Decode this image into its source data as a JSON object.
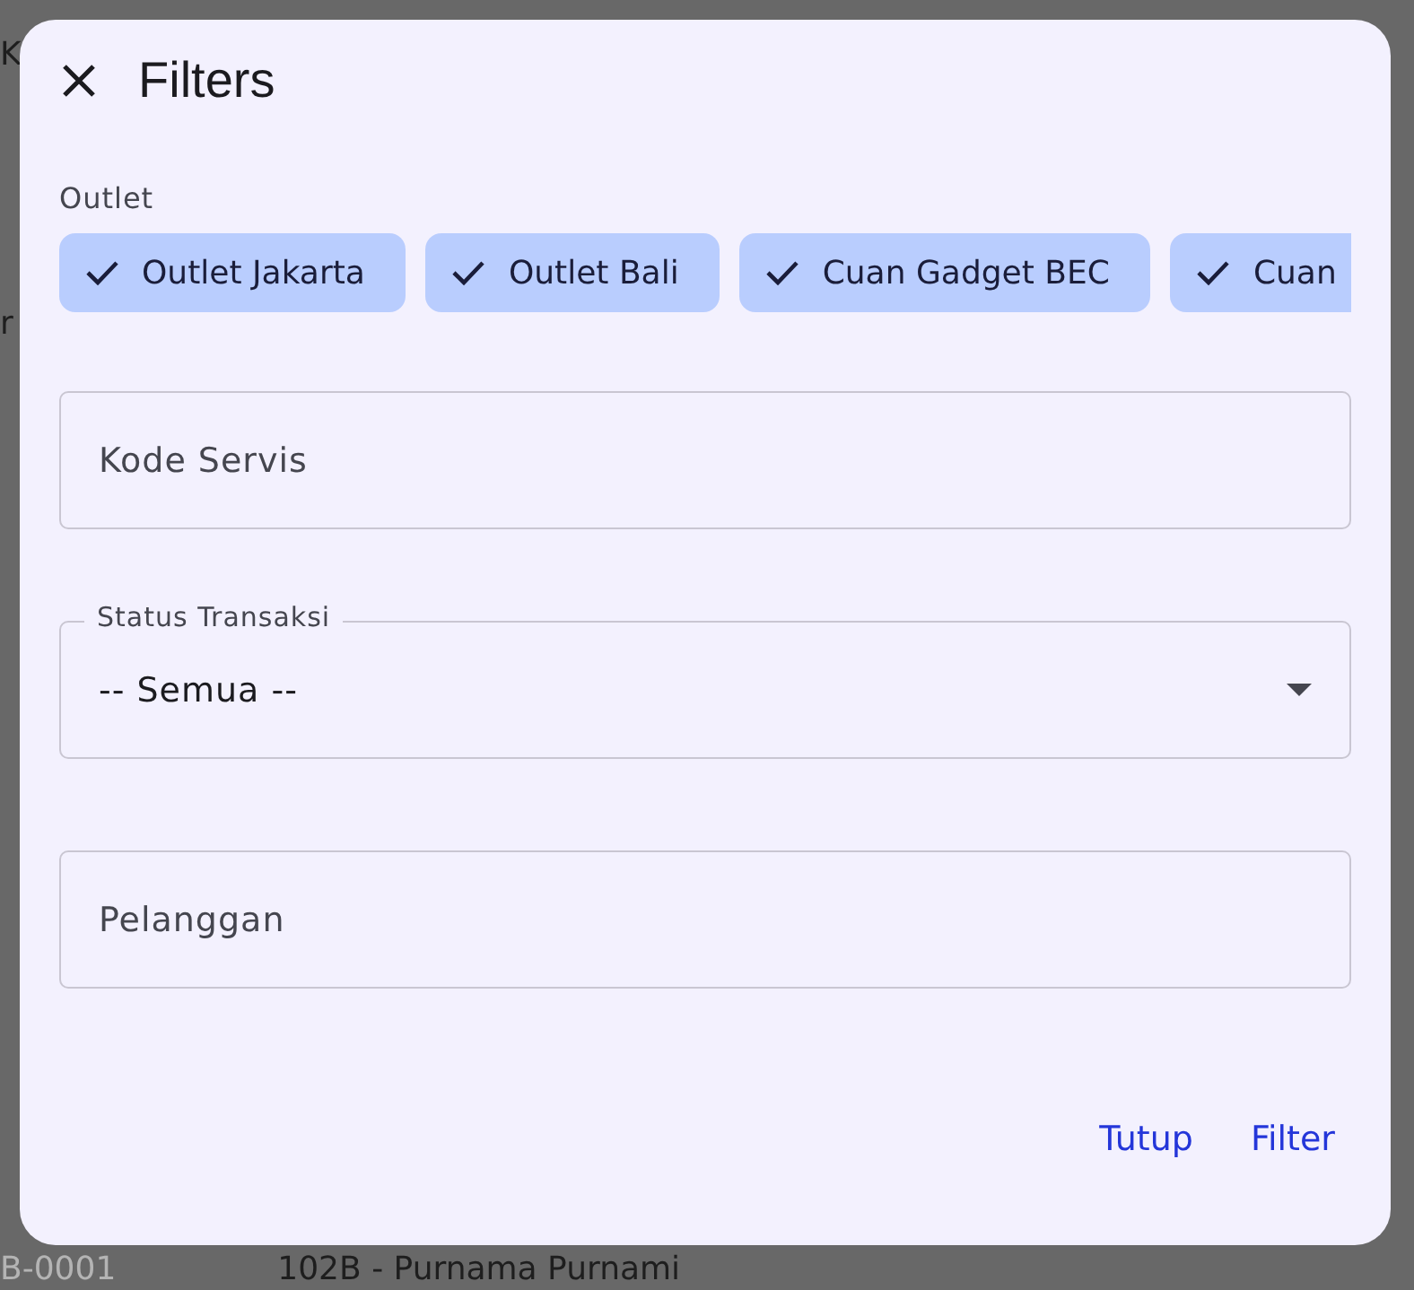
{
  "background": {
    "top_letter": "K",
    "side_letter": "r",
    "row_code": "B-0001",
    "row_text": "102B - Purnama Purnami"
  },
  "dialog": {
    "title": "Filters",
    "outlet": {
      "label": "Outlet",
      "chips": [
        {
          "label": "Outlet Jakarta",
          "selected": true
        },
        {
          "label": "Outlet Bali",
          "selected": true
        },
        {
          "label": "Cuan Gadget BEC",
          "selected": true
        },
        {
          "label": "Cuan",
          "selected": true
        }
      ]
    },
    "kode_servis": {
      "placeholder": "Kode Servis"
    },
    "status_transaksi": {
      "label": "Status Transaksi",
      "value": "-- Semua --"
    },
    "pelanggan": {
      "placeholder": "Pelanggan"
    },
    "buttons": [
      "Tutup",
      "Filter"
    ]
  }
}
